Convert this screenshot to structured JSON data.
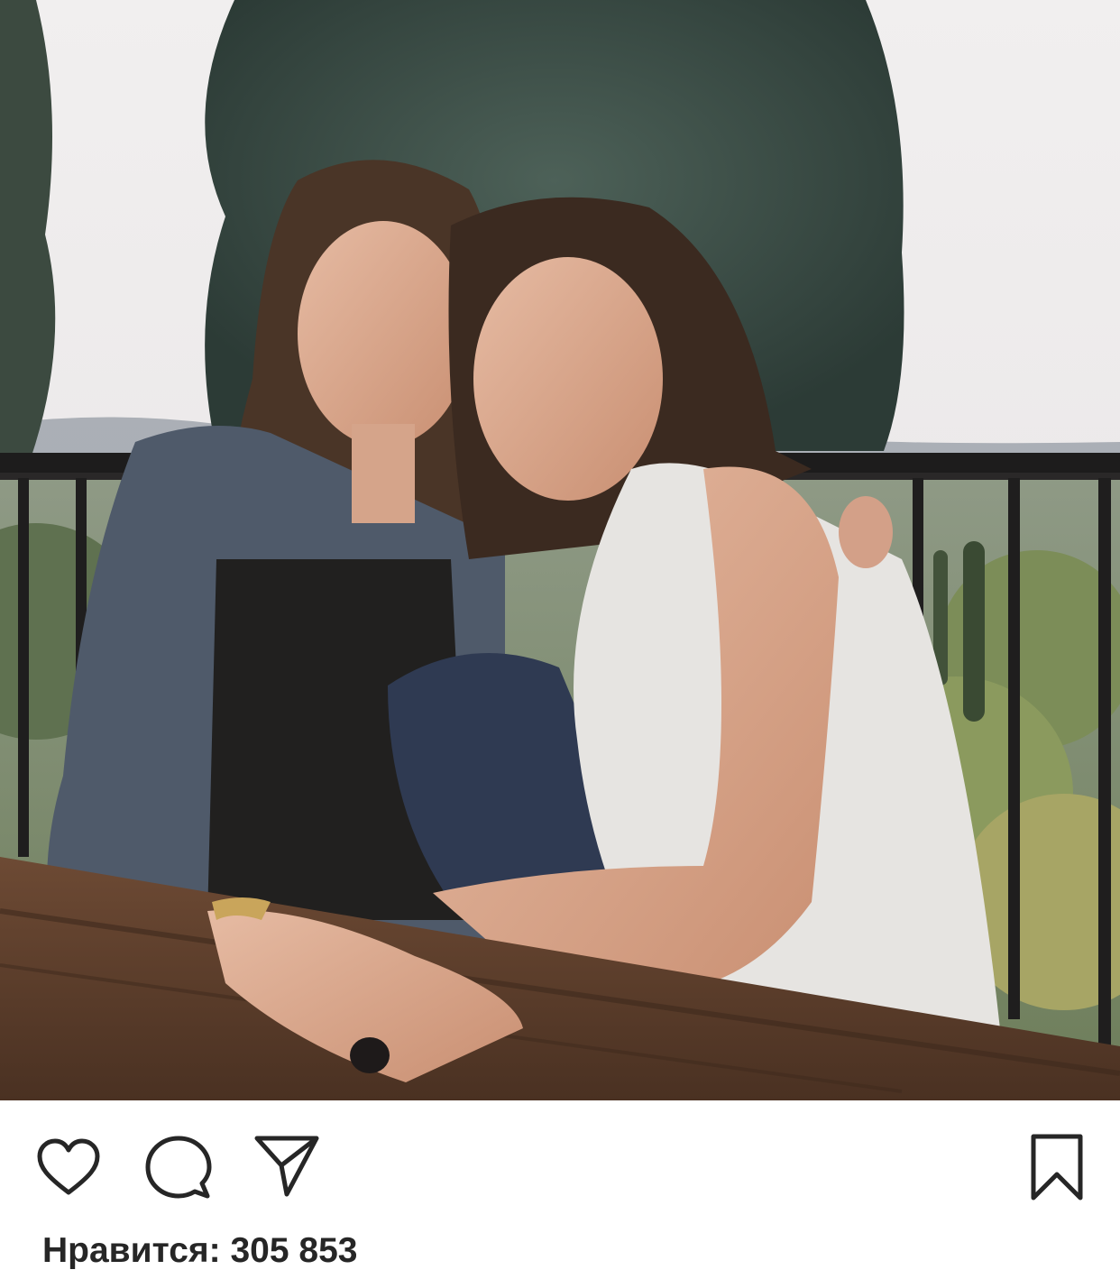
{
  "post": {
    "photo_icon": "photo",
    "actions": {
      "like_icon": "heart-icon",
      "comment_icon": "comment-bubble-icon",
      "share_icon": "paper-plane-icon",
      "save_icon": "bookmark-icon"
    },
    "likes_text": "Нравится: 305 853"
  },
  "colors": {
    "icon": "#262626",
    "text": "#262626",
    "background": "#ffffff"
  }
}
